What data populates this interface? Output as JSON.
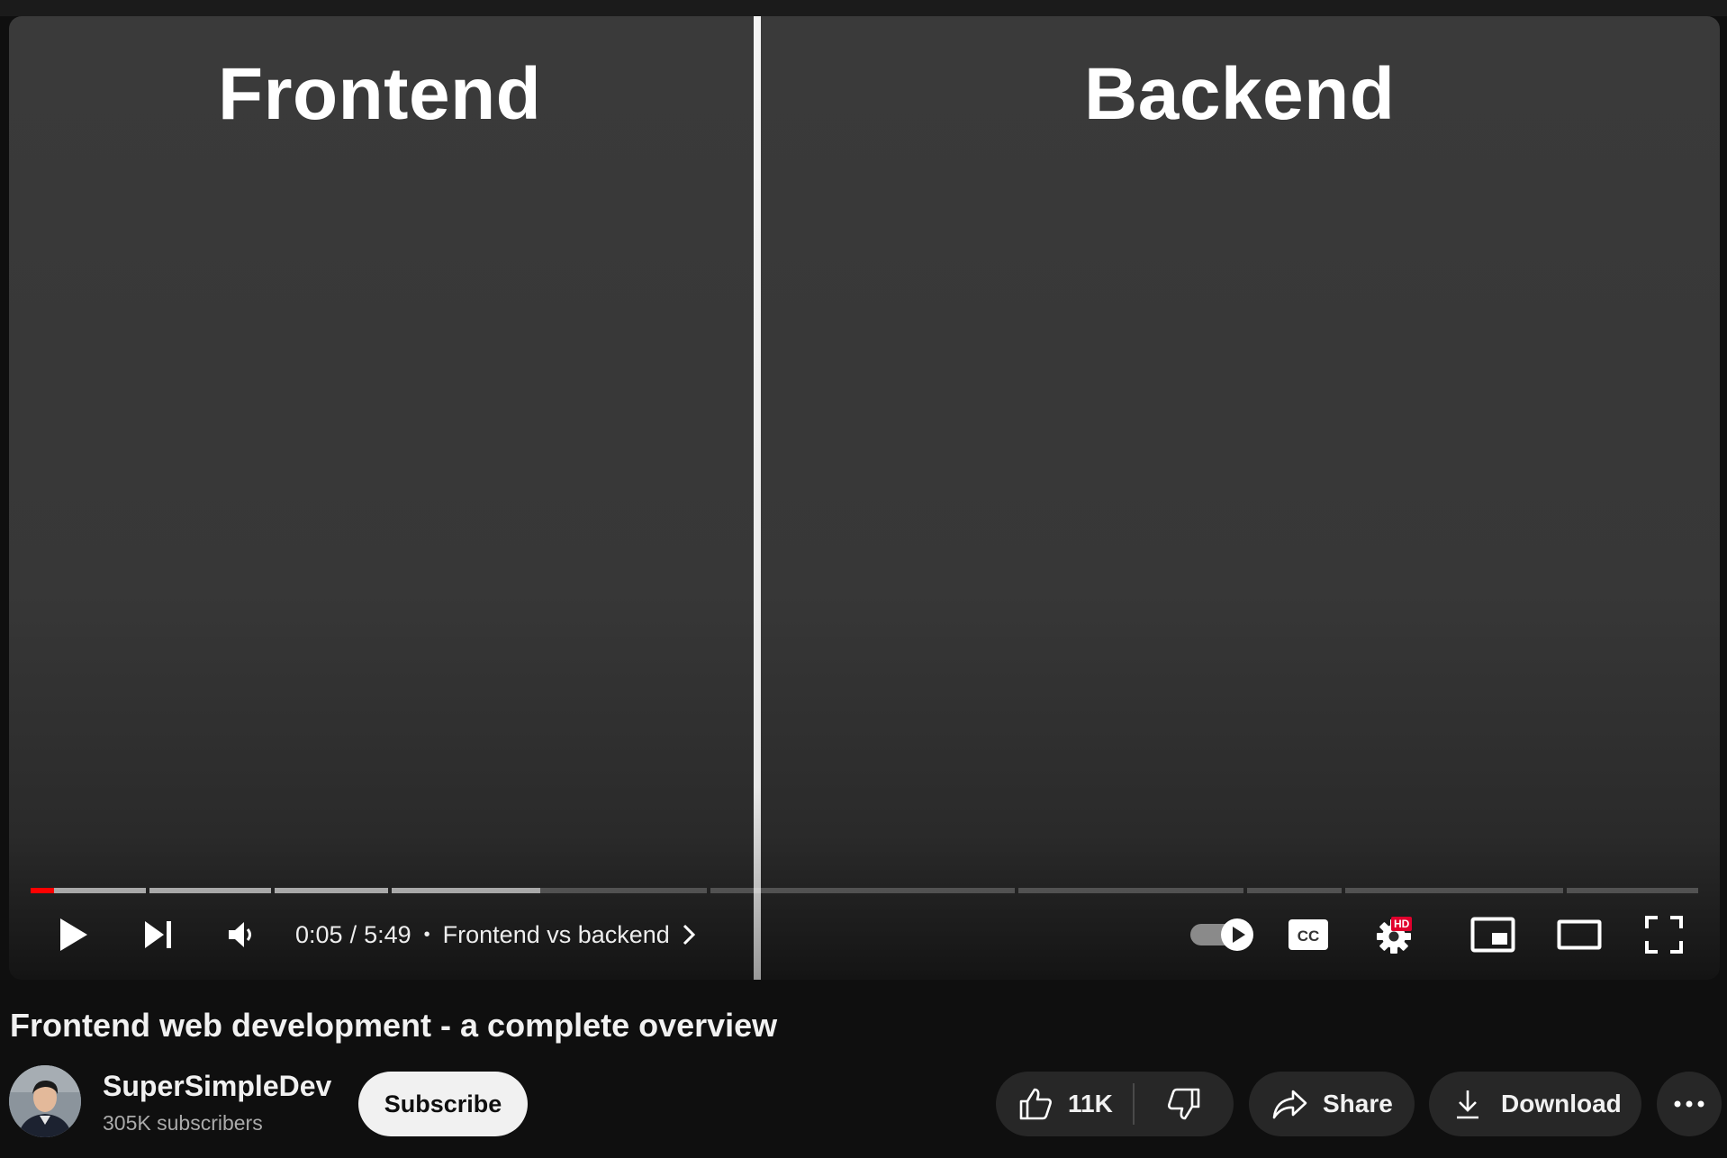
{
  "player": {
    "left_heading": "Frontend",
    "right_heading": "Backend",
    "progress_fraction": 0.014,
    "time_current": "0:05",
    "time_total": "5:49",
    "time_separator": "/",
    "chapter_title": "Frontend vs backend",
    "hd_badge": "HD",
    "controls": [
      "play-icon",
      "next-icon",
      "volume-icon",
      "autoplay-toggle",
      "cc-icon",
      "settings-icon",
      "miniplayer-icon",
      "theater-icon",
      "fullscreen-icon"
    ],
    "accent_color": "#ff0000"
  },
  "video": {
    "title": "Frontend web development - a complete overview"
  },
  "channel": {
    "name": "SuperSimpleDev",
    "subscribers": "305K subscribers",
    "subscribe_label": "Subscribe"
  },
  "actions": {
    "like_count": "11K",
    "share_label": "Share",
    "download_label": "Download"
  }
}
